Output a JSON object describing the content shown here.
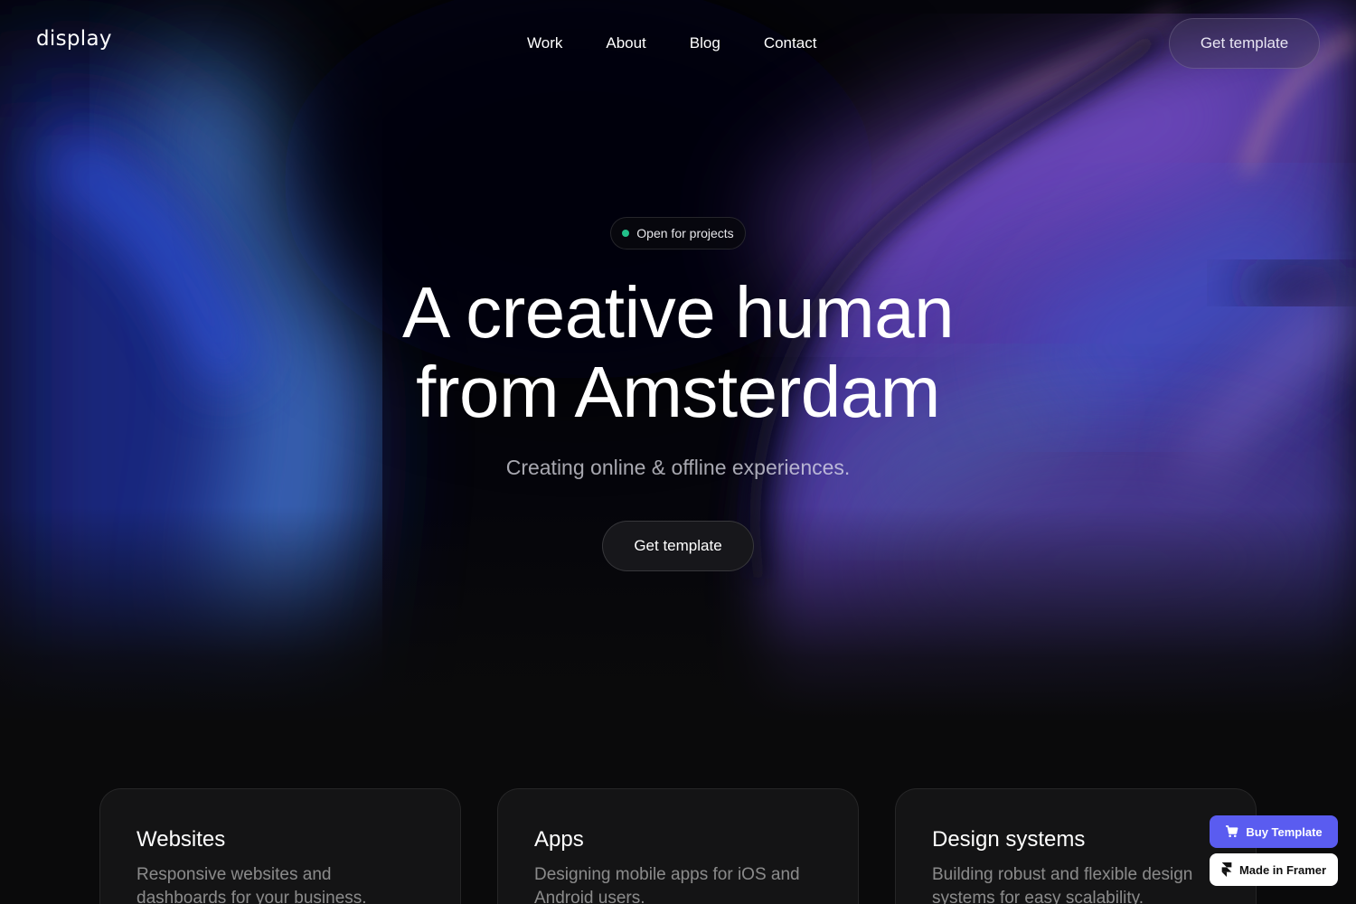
{
  "brand": {
    "logo": "display"
  },
  "nav": {
    "links": [
      "Work",
      "About",
      "Blog",
      "Contact"
    ],
    "cta_label": "Get template"
  },
  "hero": {
    "badge": {
      "text": "Open for projects",
      "dot_color": "#22c08a"
    },
    "headline_line1": "A creative human",
    "headline_line2": "from Amsterdam",
    "subheadline": "Creating online & offline experiences.",
    "cta_label": "Get template"
  },
  "services": [
    {
      "title": "Websites",
      "description": "Responsive websites and dashboards for your business."
    },
    {
      "title": "Apps",
      "description": "Designing mobile apps for iOS and Android users."
    },
    {
      "title": "Design systems",
      "description": "Building robust and flexible design systems for easy scalability."
    }
  ],
  "framer_badges": {
    "buy_label": "Buy Template",
    "buy_icon": "cart-icon",
    "buy_color": "#5a5cf0",
    "made_label": "Made in Framer",
    "made_icon": "framer-logo-icon"
  },
  "colors": {
    "background": "#0a0a0b",
    "card": "#141415",
    "accent_status": "#22c08a"
  }
}
